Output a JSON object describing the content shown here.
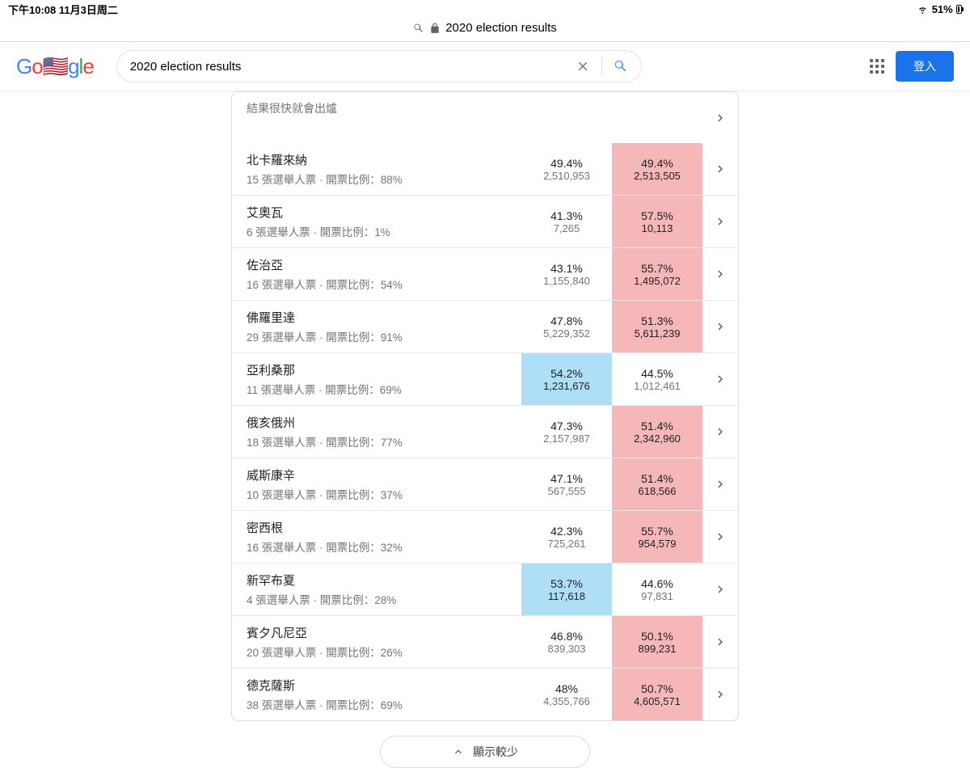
{
  "status": {
    "time_date": "下午10:08   11月3日周二",
    "battery_pct": "51%"
  },
  "url_bar": {
    "text": "2020 election results"
  },
  "header": {
    "search_value": "2020 election results",
    "signin": "登入"
  },
  "results": {
    "coming_soon": "結果很快就會出爐",
    "ev_label": "張選舉人票",
    "ratio_label": "開票比例",
    "rows": [
      {
        "name": "北卡羅來納",
        "ev": "15",
        "ratio": "88%",
        "left_pct": "49.4%",
        "left_votes": "2,510,953",
        "right_pct": "49.4%",
        "right_votes": "2,513,505",
        "hl": "right-red"
      },
      {
        "name": "艾奧瓦",
        "ev": "6",
        "ratio": "1%",
        "left_pct": "41.3%",
        "left_votes": "7,265",
        "right_pct": "57.5%",
        "right_votes": "10,113",
        "hl": "right-red"
      },
      {
        "name": "佐治亞",
        "ev": "16",
        "ratio": "54%",
        "left_pct": "43.1%",
        "left_votes": "1,155,840",
        "right_pct": "55.7%",
        "right_votes": "1,495,072",
        "hl": "right-red"
      },
      {
        "name": "佛羅里達",
        "ev": "29",
        "ratio": "91%",
        "left_pct": "47.8%",
        "left_votes": "5,229,352",
        "right_pct": "51.3%",
        "right_votes": "5,611,239",
        "hl": "right-red"
      },
      {
        "name": "亞利桑那",
        "ev": "11",
        "ratio": "69%",
        "left_pct": "54.2%",
        "left_votes": "1,231,676",
        "right_pct": "44.5%",
        "right_votes": "1,012,461",
        "hl": "left-blue"
      },
      {
        "name": "俄亥俄州",
        "ev": "18",
        "ratio": "77%",
        "left_pct": "47.3%",
        "left_votes": "2,157,987",
        "right_pct": "51.4%",
        "right_votes": "2,342,960",
        "hl": "right-red"
      },
      {
        "name": "威斯康辛",
        "ev": "10",
        "ratio": "37%",
        "left_pct": "47.1%",
        "left_votes": "567,555",
        "right_pct": "51.4%",
        "right_votes": "618,566",
        "hl": "right-red"
      },
      {
        "name": "密西根",
        "ev": "16",
        "ratio": "32%",
        "left_pct": "42.3%",
        "left_votes": "725,261",
        "right_pct": "55.7%",
        "right_votes": "954,579",
        "hl": "right-red"
      },
      {
        "name": "新罕布夏",
        "ev": "4",
        "ratio": "28%",
        "left_pct": "53.7%",
        "left_votes": "117,618",
        "right_pct": "44.6%",
        "right_votes": "97,831",
        "hl": "left-blue"
      },
      {
        "name": "賓夕凡尼亞",
        "ev": "20",
        "ratio": "26%",
        "left_pct": "46.8%",
        "left_votes": "839,303",
        "right_pct": "50.1%",
        "right_votes": "899,231",
        "hl": "right-red"
      },
      {
        "name": "德克薩斯",
        "ev": "38",
        "ratio": "69%",
        "left_pct": "48%",
        "left_votes": "4,355,766",
        "right_pct": "50.7%",
        "right_votes": "4,605,571",
        "hl": "right-red"
      }
    ],
    "show_less": "顯示較少"
  }
}
